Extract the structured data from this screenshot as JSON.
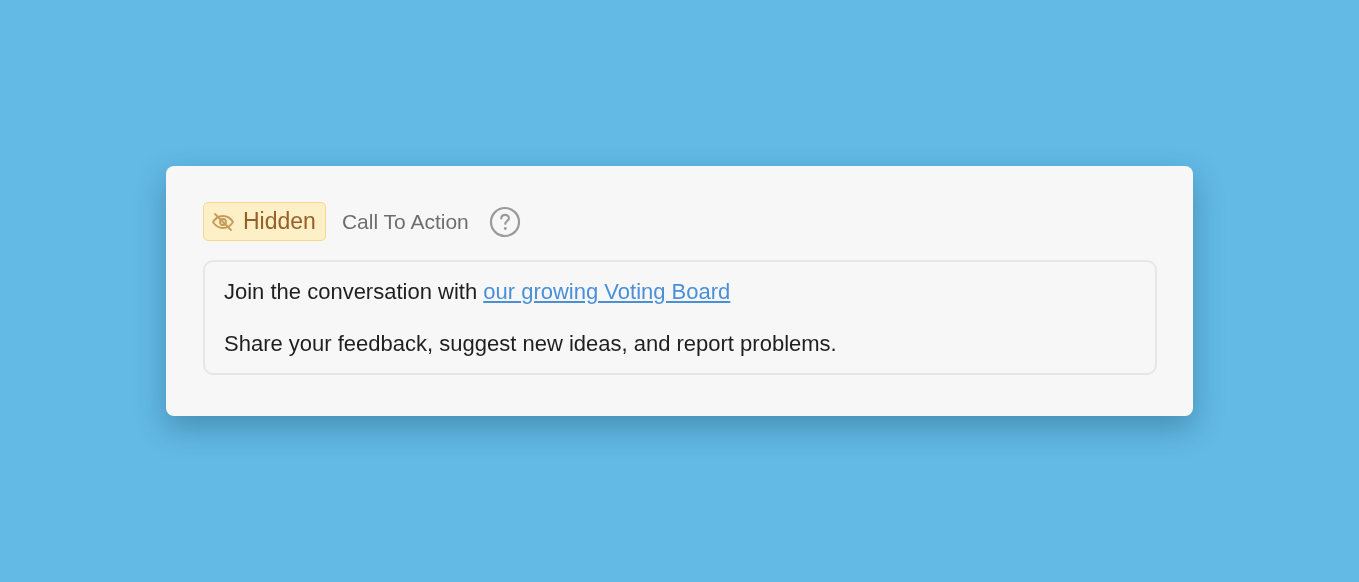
{
  "block": {
    "status": {
      "label": "Hidden",
      "kind": "hidden"
    },
    "title": "Call To Action",
    "paragraphs": [
      {
        "text": "Join the conversation with ",
        "link": "our growing Voting Board"
      },
      {
        "text": "Share your feedback, suggest new ideas, and report problems."
      }
    ]
  }
}
